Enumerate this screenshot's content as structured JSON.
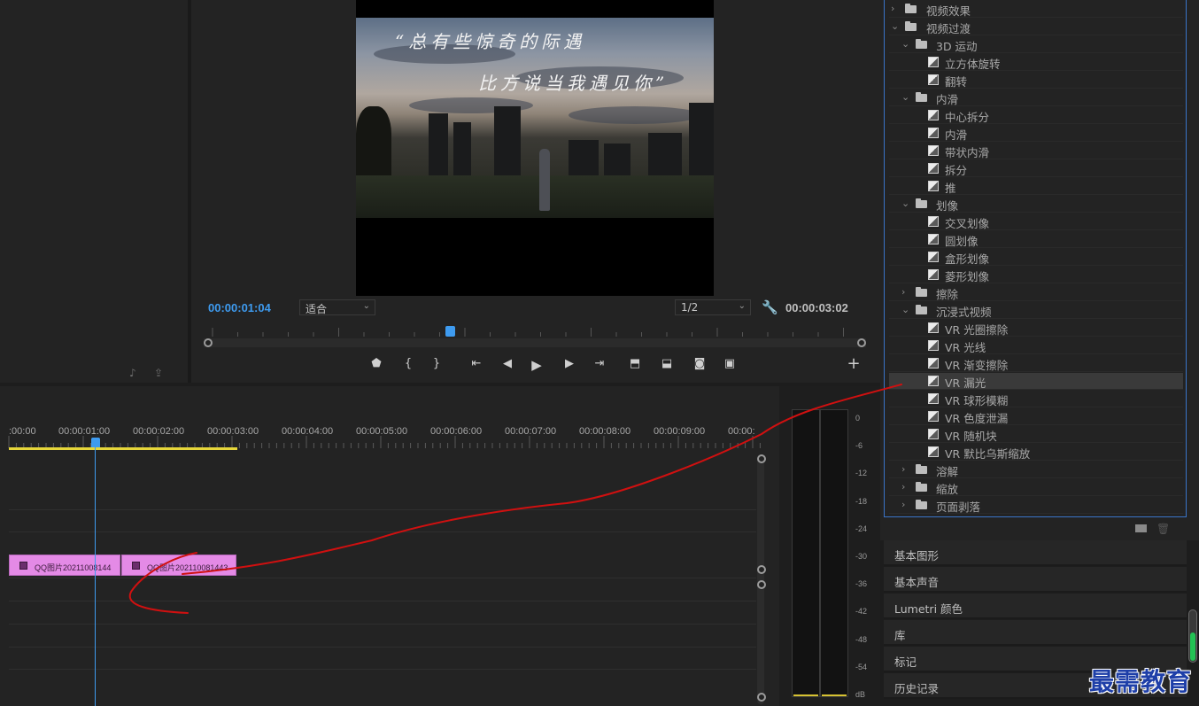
{
  "monitor": {
    "current_timecode": "00:00:01:04",
    "duration_timecode": "00:00:03:02",
    "zoom_select": "适合",
    "resolution_select": "1/2",
    "caption_line1": "“总有些惊奇的际遇",
    "caption_line2": "比方说当我遇见你”",
    "controls": [
      "marker-icon",
      "mark-in-icon",
      "mark-out-icon",
      "go-to-in-icon",
      "step-back-icon",
      "play-icon",
      "step-forward-icon",
      "go-to-out-icon",
      "lift-icon",
      "extract-icon",
      "export-frame-icon",
      "comparison-icon",
      "add-button-icon"
    ]
  },
  "effects_panel": {
    "items": [
      {
        "label": "视频效果",
        "type": "folder",
        "level": 0,
        "expanded": false
      },
      {
        "label": "视频过渡",
        "type": "folder",
        "level": 0,
        "expanded": true
      },
      {
        "label": "3D 运动",
        "type": "folder",
        "level": 1,
        "expanded": true
      },
      {
        "label": "立方体旋转",
        "type": "preset",
        "level": 2
      },
      {
        "label": "翻转",
        "type": "preset",
        "level": 2
      },
      {
        "label": "内滑",
        "type": "folder",
        "level": 1,
        "expanded": true
      },
      {
        "label": "中心拆分",
        "type": "preset",
        "level": 2
      },
      {
        "label": "内滑",
        "type": "preset",
        "level": 2
      },
      {
        "label": "带状内滑",
        "type": "preset",
        "level": 2
      },
      {
        "label": "拆分",
        "type": "preset",
        "level": 2
      },
      {
        "label": "推",
        "type": "preset",
        "level": 2
      },
      {
        "label": "划像",
        "type": "folder",
        "level": 1,
        "expanded": true
      },
      {
        "label": "交叉划像",
        "type": "preset",
        "level": 2
      },
      {
        "label": "圆划像",
        "type": "preset",
        "level": 2
      },
      {
        "label": "盒形划像",
        "type": "preset",
        "level": 2
      },
      {
        "label": "菱形划像",
        "type": "preset",
        "level": 2
      },
      {
        "label": "擦除",
        "type": "folder",
        "level": 1,
        "expanded": false
      },
      {
        "label": "沉浸式视频",
        "type": "folder",
        "level": 1,
        "expanded": true
      },
      {
        "label": "VR 光圈擦除",
        "type": "preset",
        "level": 2
      },
      {
        "label": "VR 光线",
        "type": "preset",
        "level": 2
      },
      {
        "label": "VR 渐变擦除",
        "type": "preset",
        "level": 2
      },
      {
        "label": "VR 漏光",
        "type": "preset",
        "level": 2,
        "selected": true
      },
      {
        "label": "VR 球形模糊",
        "type": "preset",
        "level": 2
      },
      {
        "label": "VR 色度泄漏",
        "type": "preset",
        "level": 2
      },
      {
        "label": "VR 随机块",
        "type": "preset",
        "level": 2
      },
      {
        "label": "VR 默比乌斯缩放",
        "type": "preset",
        "level": 2
      },
      {
        "label": "溶解",
        "type": "folder",
        "level": 1,
        "expanded": false
      },
      {
        "label": "缩放",
        "type": "folder",
        "level": 1,
        "expanded": false
      },
      {
        "label": "页面剥落",
        "type": "folder",
        "level": 1,
        "expanded": false
      }
    ]
  },
  "side_panels": [
    "基本图形",
    "基本声音",
    "Lumetri 颜色",
    "库",
    "标记",
    "历史记录"
  ],
  "timeline": {
    "ruler": [
      ":00:00",
      "00:00:01:00",
      "00:00:02:00",
      "00:00:03:00",
      "00:00:04:00",
      "00:00:05:00",
      "00:00:06:00",
      "00:00:07:00",
      "00:00:08:00",
      "00:00:09:00",
      "00:00:"
    ],
    "clips": [
      "QQ图片20211008144",
      "QQ图片202110081443"
    ]
  },
  "audio_meter": {
    "db_labels": [
      "0",
      "-6",
      "-12",
      "-18",
      "-24",
      "-30",
      "-36",
      "-42",
      "-48",
      "-54",
      "dB"
    ]
  },
  "watermark": "最需教育",
  "colors": {
    "accent": "#3e9bf0",
    "clip": "#e48ae6",
    "work_area": "#e6d63a",
    "annotation": "#d01010",
    "selection_border": "#3a74c8"
  }
}
